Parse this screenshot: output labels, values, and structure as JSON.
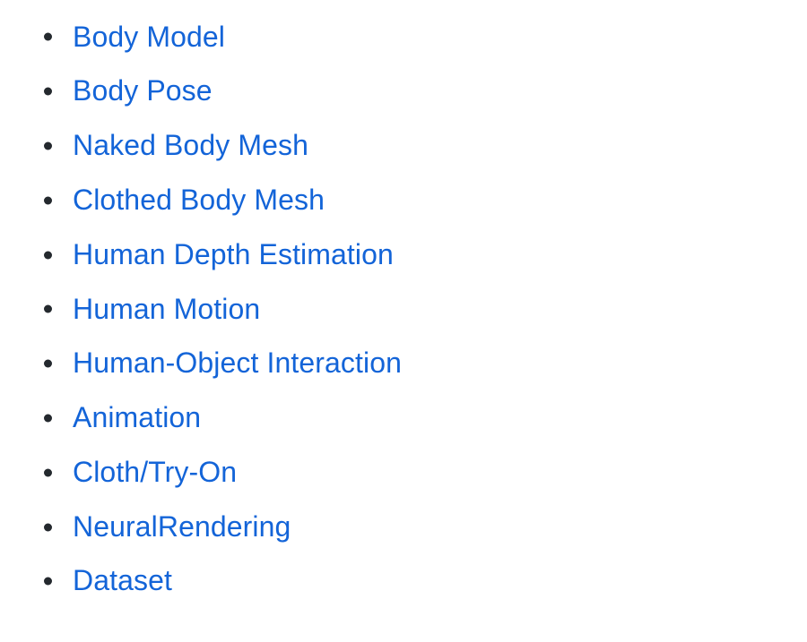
{
  "page": {
    "background_color": "#ffffff",
    "link_color": "#1364d8",
    "bullet_color": "#24292e",
    "bullet_icon": "bullet-dot-icon"
  },
  "list": {
    "type": "unordered-bulleted",
    "items": [
      {
        "label": "Body Model"
      },
      {
        "label": "Body Pose"
      },
      {
        "label": "Naked Body Mesh"
      },
      {
        "label": "Clothed Body Mesh"
      },
      {
        "label": "Human Depth Estimation"
      },
      {
        "label": "Human Motion"
      },
      {
        "label": "Human-Object Interaction"
      },
      {
        "label": "Animation"
      },
      {
        "label": "Cloth/Try-On"
      },
      {
        "label": "NeuralRendering"
      },
      {
        "label": "Dataset"
      }
    ]
  }
}
